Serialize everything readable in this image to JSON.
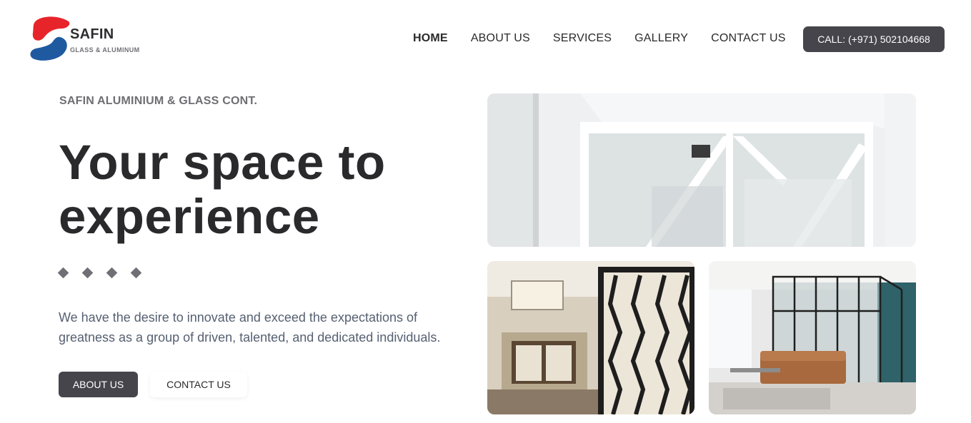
{
  "brand": {
    "name": "SAFIN",
    "tagline": "GLASS & ALUMINUM",
    "colors": {
      "red": "#e8242b",
      "blue": "#1f5aa0"
    }
  },
  "nav": {
    "items": [
      {
        "label": "HOME",
        "active": true
      },
      {
        "label": "ABOUT US",
        "active": false
      },
      {
        "label": "SERVICES",
        "active": false
      },
      {
        "label": "GALLERY",
        "active": false
      },
      {
        "label": "CONTACT US",
        "active": false
      }
    ],
    "call_label": "CALL: (+971) 502104668"
  },
  "hero": {
    "eyebrow": "SAFIN ALUMINIUM & GLASS CONT.",
    "headline_line1": "Your space to",
    "headline_line2": "experience",
    "description": "We have the desire to innovate and exceed the expectations of greatness as a group of driven, talented, and dedicated individuals.",
    "primary_button": "ABOUT US",
    "secondary_button": "CONTACT US"
  },
  "theme": {
    "dark_button": "#45454b",
    "text_dark": "#2a2a2c",
    "text_muted": "#566072"
  }
}
